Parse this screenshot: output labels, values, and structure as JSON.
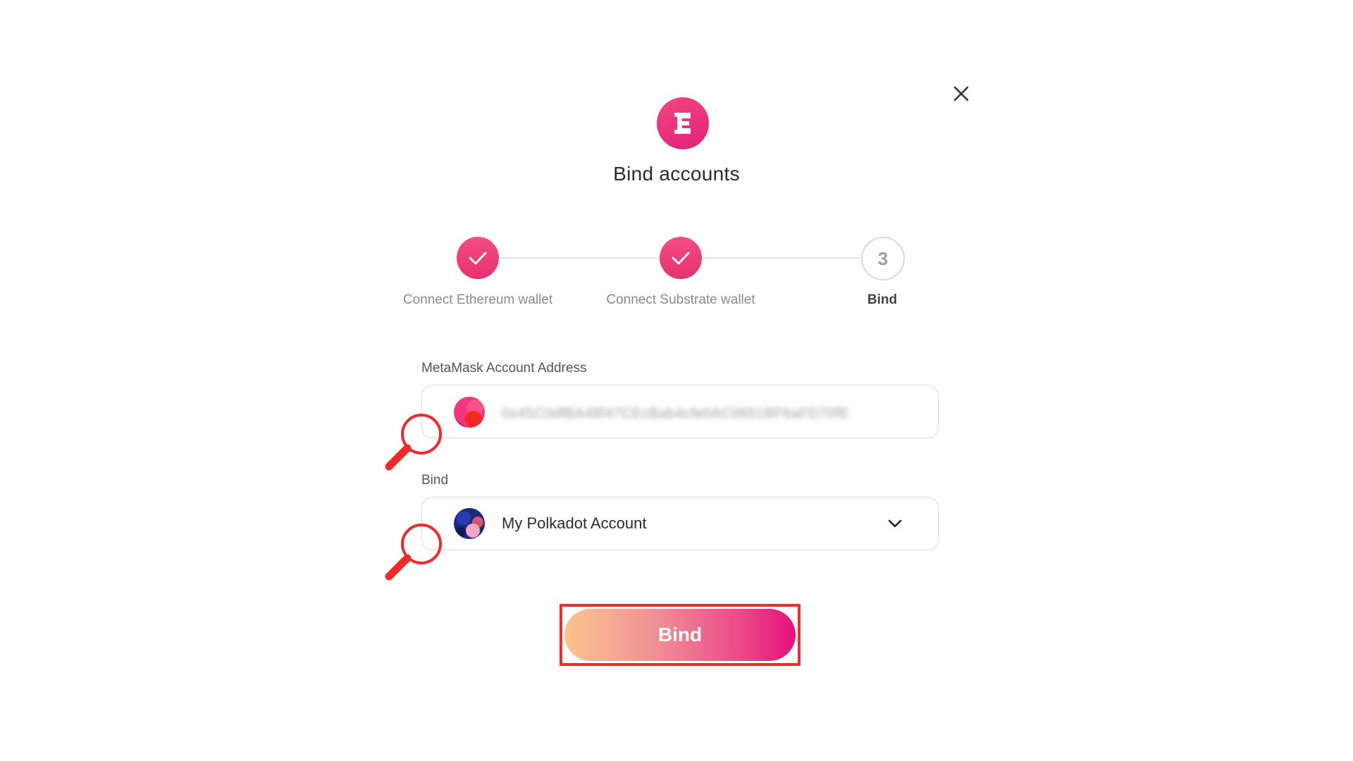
{
  "dialog": {
    "title": "Bind accounts",
    "accent_color": "#e8306f"
  },
  "stepper": {
    "steps": [
      {
        "label": "Connect Ethereum wallet",
        "state": "done"
      },
      {
        "label": "Connect Substrate wallet",
        "state": "done"
      },
      {
        "label": "Bind",
        "number": "3",
        "state": "current"
      }
    ]
  },
  "metamask": {
    "label": "MetaMask Account Address",
    "value": "0x45C0dfBA48f47CEcBab4cfe0AC0651BF6aFD70fE"
  },
  "bind_select": {
    "label": "Bind",
    "selected": "My Polkadot Account"
  },
  "bind_button": {
    "label": "Bind",
    "highlight_color": "#ef2b2b"
  },
  "icons": {
    "close": "close-icon",
    "logo": "e-logo-icon",
    "check": "check-icon",
    "chevron": "chevron-down-icon",
    "magnifier": "magnifier-icon"
  }
}
